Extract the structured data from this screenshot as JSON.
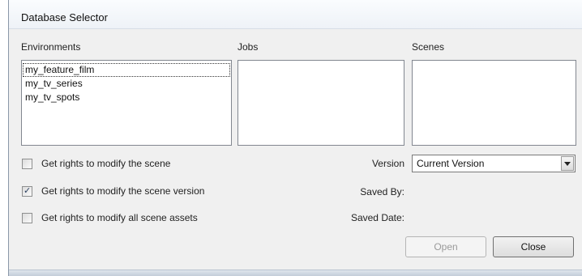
{
  "window": {
    "title": "Database Selector"
  },
  "columns": {
    "environments_label": "Environments",
    "jobs_label": "Jobs",
    "scenes_label": "Scenes"
  },
  "environments": {
    "items": [
      "my_feature_film",
      "my_tv_series",
      "my_tv_spots"
    ]
  },
  "options": {
    "modify_scene": {
      "label": "Get rights to modify the scene",
      "checked": false
    },
    "modify_scene_version": {
      "label": "Get rights to modify the scene version",
      "checked": true
    },
    "modify_all_assets": {
      "label": "Get rights to modify all scene assets",
      "checked": false
    }
  },
  "details": {
    "version_label": "Version",
    "version_value": "Current Version",
    "saved_by_label": "Saved By:",
    "saved_date_label": "Saved Date:"
  },
  "buttons": {
    "open": "Open",
    "close": "Close"
  },
  "glyphs": {
    "check": "✓"
  }
}
